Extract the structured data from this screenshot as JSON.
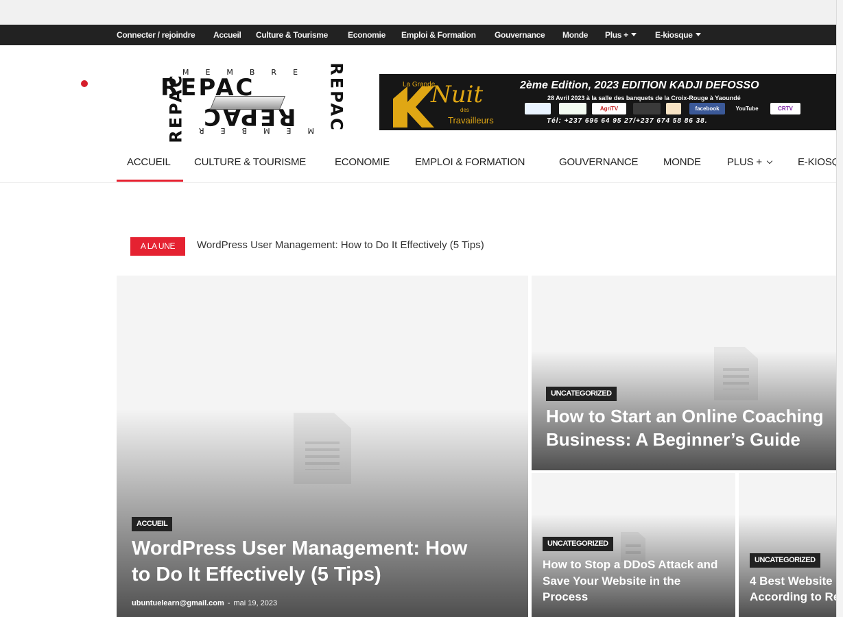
{
  "topbar": {
    "items": [
      "Connecter / rejoindre",
      "Accueil",
      "Culture & Tourisme",
      "Economie",
      "Emploi & Formation",
      "Gouvernance",
      "Monde",
      "Plus +",
      "E-kiosque"
    ]
  },
  "logo": {
    "word": "REPAC",
    "member": "MEMBRE",
    "member_bottom": "MEMBER"
  },
  "banner": {
    "tag_top": "La Grande",
    "script": "Nuit",
    "tag_des": "des",
    "tag_bottom": "Travailleurs",
    "edition": "2ème Edition, 2023  EDITION KADJI DEFOSSO",
    "date_place": "28 Avril 2023 à la salle des banquets de  la Croix-Rouge à Yaoundé",
    "sponsors": [
      "",
      "",
      "AgriTV",
      "",
      "",
      "facebook",
      "YouTube",
      "CRTV"
    ],
    "phones": "Tél: +237 696 64 95 27/+237 674 58 86 38."
  },
  "nav": {
    "items": [
      "ACCUEIL",
      "CULTURE & TOURISME",
      "ECONOMIE",
      "EMPLOI & FORMATION",
      "GOUVERNANCE",
      "MONDE",
      "PLUS +",
      "E-KIOSQ"
    ]
  },
  "ticker": {
    "label": "A LA UNE",
    "headline": "WordPress User Management: How to Do It Effectively (5 Tips)"
  },
  "posts": {
    "main": {
      "category": "ACCUEIL",
      "title_line1": "WordPress User Management: How",
      "title_line2": "to Do It Effectively (5 Tips)",
      "author": "ubuntuelearn@gmail.com",
      "separator": "-",
      "date": "mai 19, 2023"
    },
    "right_top": {
      "category": "UNCATEGORIZED",
      "title_line1": "How to Start an Online Coaching",
      "title_line2": "Business: A Beginner’s Guide"
    },
    "bottom_left": {
      "category": "UNCATEGORIZED",
      "title_line1": "How to Stop a DDoS Attack and",
      "title_line2": "Save Your Website in the",
      "title_line3": "Process"
    },
    "bottom_right": {
      "category": "UNCATEGORIZED",
      "title_line1": "4 Best Website",
      "title_line2": "According to Re"
    }
  },
  "colors": {
    "accent": "#e52231",
    "topbar_bg": "#222222",
    "banner_gold": "#e0a714"
  }
}
